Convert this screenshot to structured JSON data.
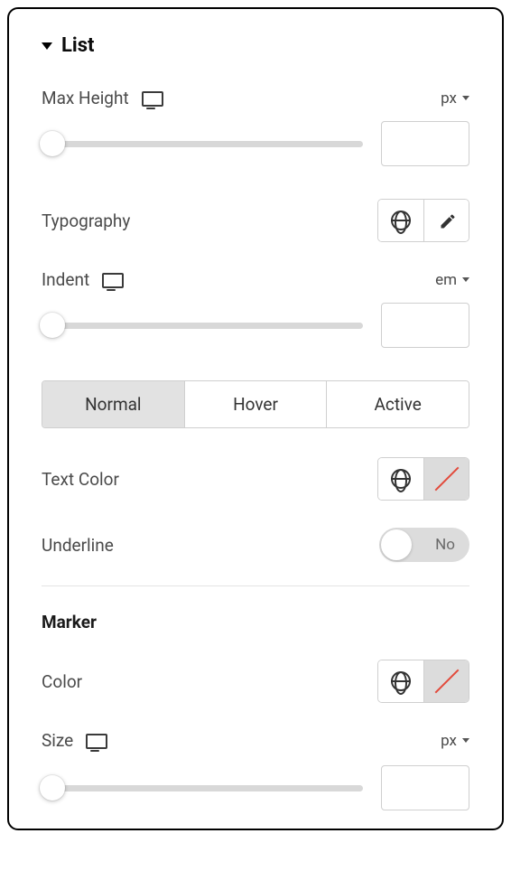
{
  "section": {
    "title": "List"
  },
  "maxHeight": {
    "label": "Max Height",
    "unit": "px",
    "value": ""
  },
  "typography": {
    "label": "Typography"
  },
  "indent": {
    "label": "Indent",
    "unit": "em",
    "value": ""
  },
  "tabs": {
    "normal": "Normal",
    "hover": "Hover",
    "active": "Active"
  },
  "textColor": {
    "label": "Text Color"
  },
  "underline": {
    "label": "Underline",
    "value": "No"
  },
  "marker": {
    "heading": "Marker",
    "color": {
      "label": "Color"
    },
    "size": {
      "label": "Size",
      "unit": "px",
      "value": ""
    }
  }
}
